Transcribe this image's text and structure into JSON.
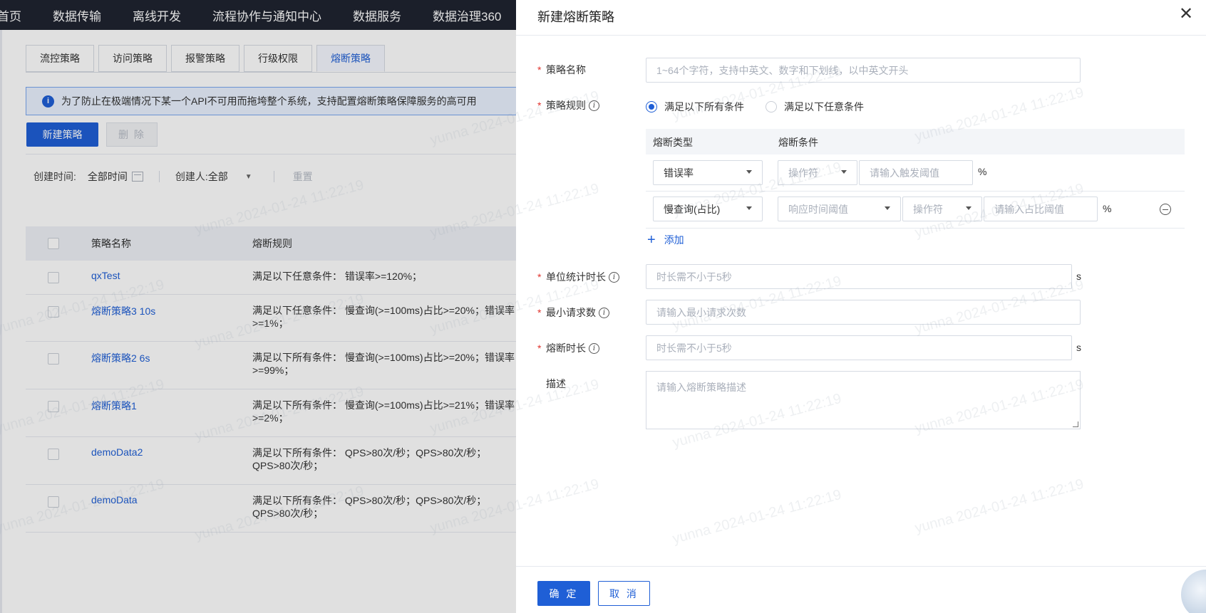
{
  "topnav": {
    "items": [
      "首页",
      "数据传输",
      "离线开发",
      "流程协作与通知中心",
      "数据服务",
      "数据治理360"
    ]
  },
  "tabs": [
    "流控策略",
    "访问策略",
    "报警策略",
    "行级权限",
    "熔断策略"
  ],
  "active_tab": "熔断策略",
  "notice": {
    "icon": "info-icon",
    "text": "为了防止在极端情况下某一个API不可用而拖垮整个系统，支持配置熔断策略保障服务的高可用"
  },
  "toolbar": {
    "new_label": "新建策略",
    "delete_label": "删 除"
  },
  "filters": {
    "time_label": "创建时间:",
    "time_value": "全部时间",
    "creator_label": "创建人:",
    "creator_value": "全部",
    "reset_label": "重置"
  },
  "table": {
    "headers": [
      "策略名称",
      "熔断规则"
    ],
    "rows": [
      {
        "name": "qxTest",
        "rule": "满足以下任意条件：  错误率>=120%；"
      },
      {
        "name": "熔断策略3 10s",
        "rule": "满足以下任意条件：  慢查询(>=100ms)占比>=20%；错误率>=1%；"
      },
      {
        "name": "熔断策略2 6s",
        "rule": "满足以下所有条件：  慢查询(>=100ms)占比>=20%；错误率>=99%；"
      },
      {
        "name": "熔断策略1",
        "rule": "满足以下所有条件：  慢查询(>=100ms)占比>=21%；错误率>=2%；"
      },
      {
        "name": "demoData2",
        "rule": "满足以下所有条件：  QPS>80次/秒；QPS>80次/秒；QPS>80次/秒；"
      },
      {
        "name": "demoData",
        "rule": "满足以下所有条件：  QPS>80次/秒；QPS>80次/秒；QPS>80次/秒；"
      }
    ]
  },
  "drawer": {
    "title": "新建熔断策略",
    "close_icon": "close-icon",
    "name_label": "策略名称",
    "name_placeholder": "1~64个字符，支持中英文、数字和下划线，以中英文开头",
    "rule_label": "策略规则",
    "rule_options": [
      "满足以下所有条件",
      "满足以下任意条件"
    ],
    "rule_selected": "满足以下所有条件",
    "cond_headers": [
      "熔断类型",
      "熔断条件"
    ],
    "cond_rows": [
      {
        "type": "错误率",
        "operator": "操作符",
        "threshold_placeholder": "请输入触发阈值",
        "unit": "%"
      },
      {
        "type": "慢查询(占比)",
        "response_placeholder": "响应时间阈值",
        "operator": "操作符",
        "threshold_placeholder": "请输入占比阈值",
        "unit": "%"
      }
    ],
    "add_label": "添加",
    "stat_label": "单位统计时长",
    "stat_placeholder": "时长需不小于5秒",
    "stat_unit": "s",
    "min_req_label": "最小请求数",
    "min_req_placeholder": "请输入最小请求次数",
    "break_label": "熔断时长",
    "break_placeholder": "时长需不小于5秒",
    "break_unit": "s",
    "desc_label": "描述",
    "desc_placeholder": "请输入熔断策略描述",
    "ok_label": "确 定",
    "cancel_label": "取 消"
  },
  "watermark": "yunna 2024-01-24 11:22:19",
  "colors": {
    "primary": "#1f5fd6",
    "required": "#e0332d",
    "nav_bg": "#1f2430"
  }
}
